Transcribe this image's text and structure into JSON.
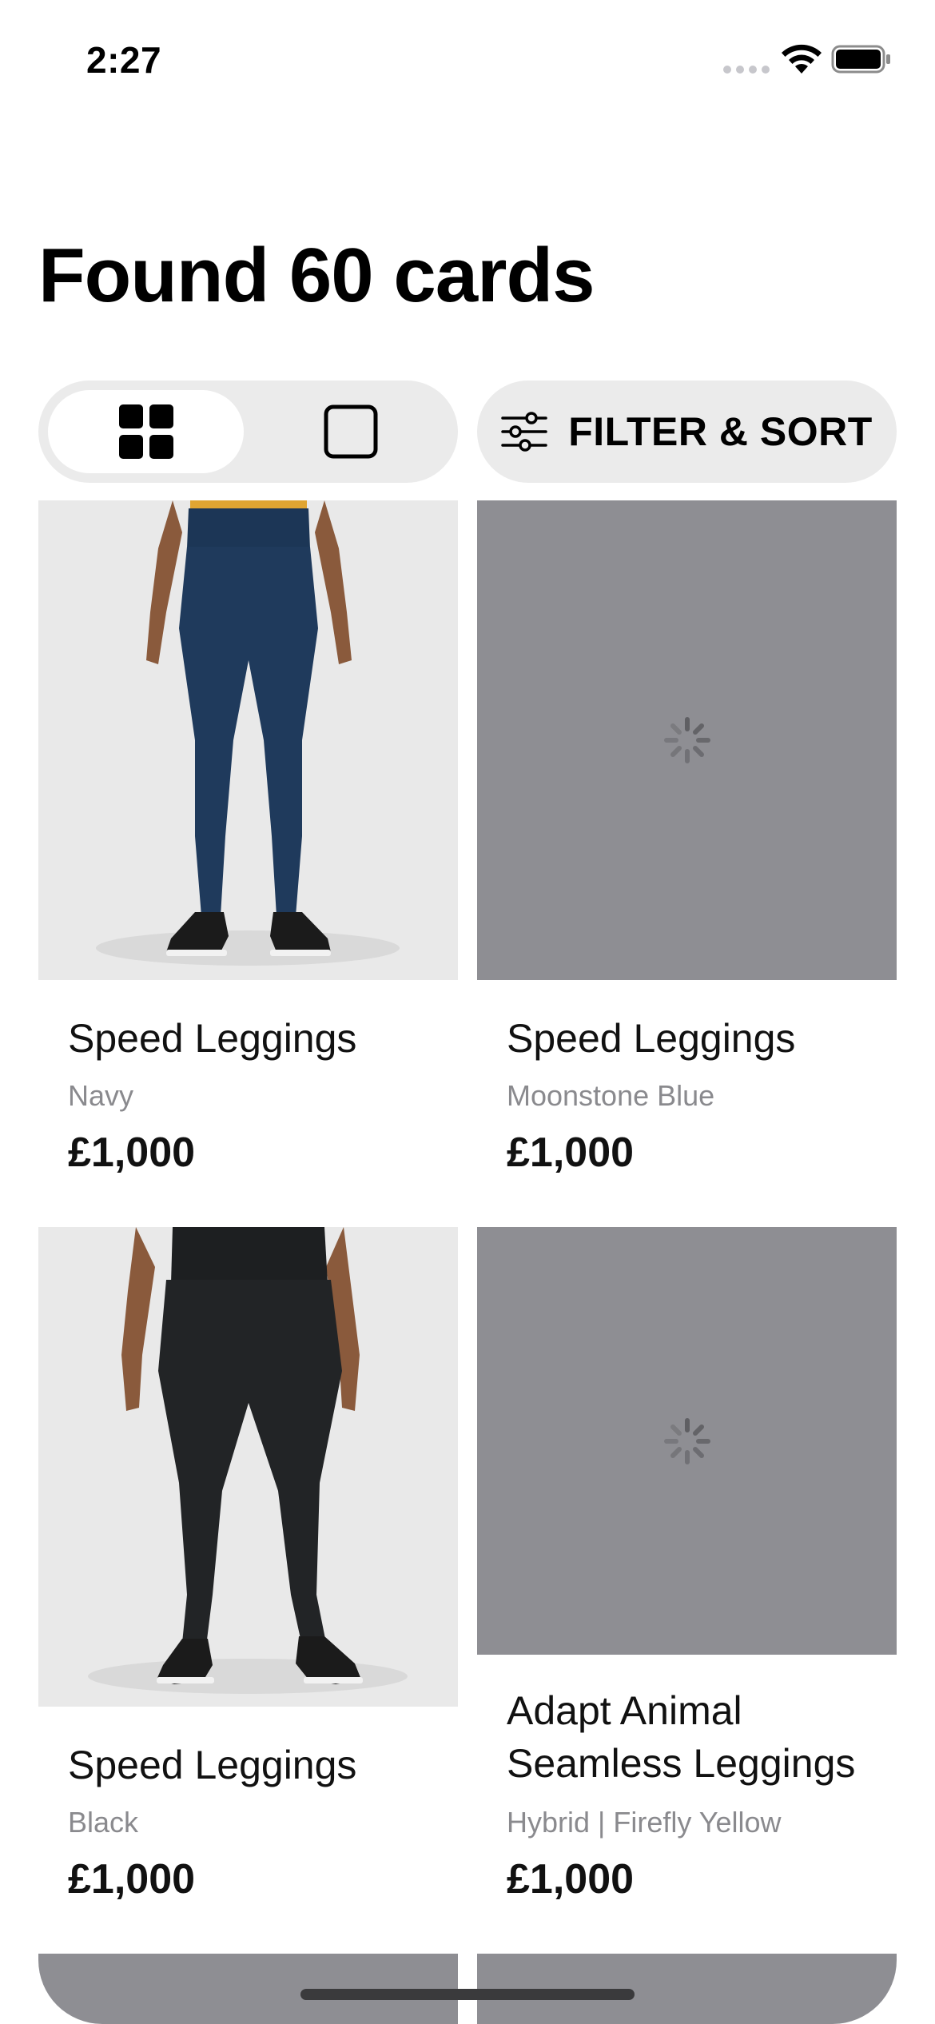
{
  "status_bar": {
    "time": "2:27",
    "icons": [
      "cellular-signal-icon",
      "wifi-icon",
      "battery-icon"
    ]
  },
  "header": {
    "title": "Found 60 cards"
  },
  "toolbar": {
    "view_options": [
      {
        "icon": "grid-view-icon",
        "selected": true
      },
      {
        "icon": "single-view-icon",
        "selected": false
      }
    ],
    "filter_icon": "sliders-icon",
    "filter_label": "FILTER & SORT"
  },
  "colors": {
    "background": "#ffffff",
    "pill_background": "#ebebeb",
    "placeholder": "#8e8e93",
    "secondary_text": "#8a8a8e",
    "navy_product": "#1f3a5c",
    "black_product": "#222426"
  },
  "products": [
    {
      "name": "Speed Leggings",
      "variant": "Navy",
      "price": "£1,000",
      "image_state": "loaded"
    },
    {
      "name": "Speed Leggings",
      "variant": "Moonstone Blue",
      "price": "£1,000",
      "image_state": "loading"
    },
    {
      "name": "Speed Leggings",
      "variant": "Black",
      "price": "£1,000",
      "image_state": "loaded"
    },
    {
      "name": "Adapt Animal Seamless Leggings",
      "variant": "Hybrid | Firefly Yellow",
      "price": "£1,000",
      "image_state": "loading"
    }
  ]
}
